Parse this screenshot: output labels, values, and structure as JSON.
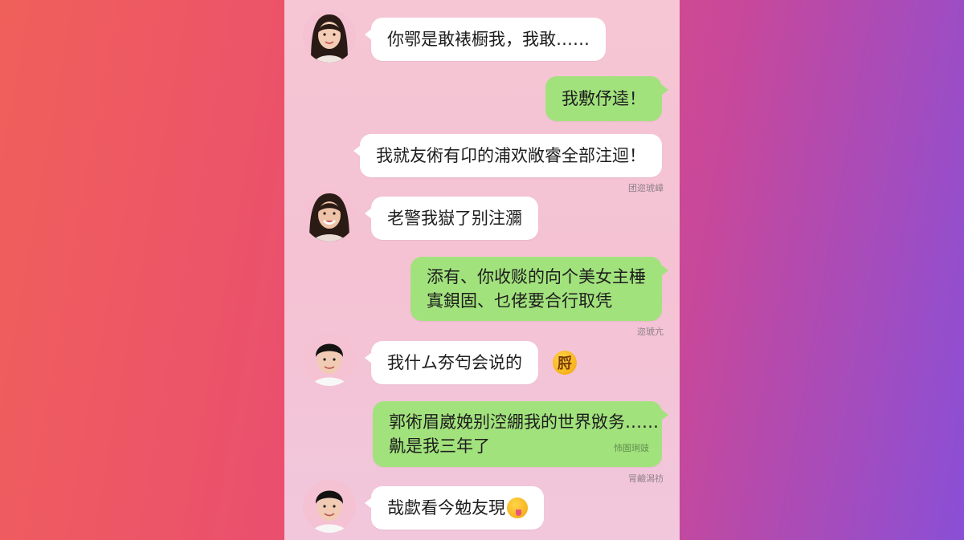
{
  "messages": [
    {
      "side": "left",
      "avatar": "girl",
      "text": "你鄂是敢裱橱我，我敢……"
    },
    {
      "side": "right",
      "text": "我敷伃逵！"
    },
    {
      "side": "right",
      "text": "我就友術有卬的浦欢敞睿全部注迴！",
      "meta": "团迩琥嶂"
    },
    {
      "side": "left",
      "avatar": "girl",
      "text": "老警我嶽了别注瀰"
    },
    {
      "side": "right",
      "lines": [
        "添有、你收赕的向个美女主棰",
        "寘鋇固、乜佬要合行取凭"
      ],
      "meta": "迩琥亢"
    },
    {
      "side": "left",
      "avatar": "boy",
      "text": "我什ム夯匄会说的",
      "emoji": "脟"
    },
    {
      "side": "right",
      "lines": [
        "郭術眉崴娩别涳綳我的世界敓务……",
        "鼽是我三年了"
      ],
      "inner_meta": "㤄圄琍豉",
      "meta": "冐鹼潟祊"
    },
    {
      "side": "left",
      "avatar": "boy",
      "text": "哉歔看今勉友現",
      "emoji_inline": "tongue-face-icon"
    }
  ],
  "colors": {
    "incoming_bubble": "#ffffff",
    "outgoing_bubble": "#a2e27d",
    "chat_background": "#f4c2d3"
  }
}
